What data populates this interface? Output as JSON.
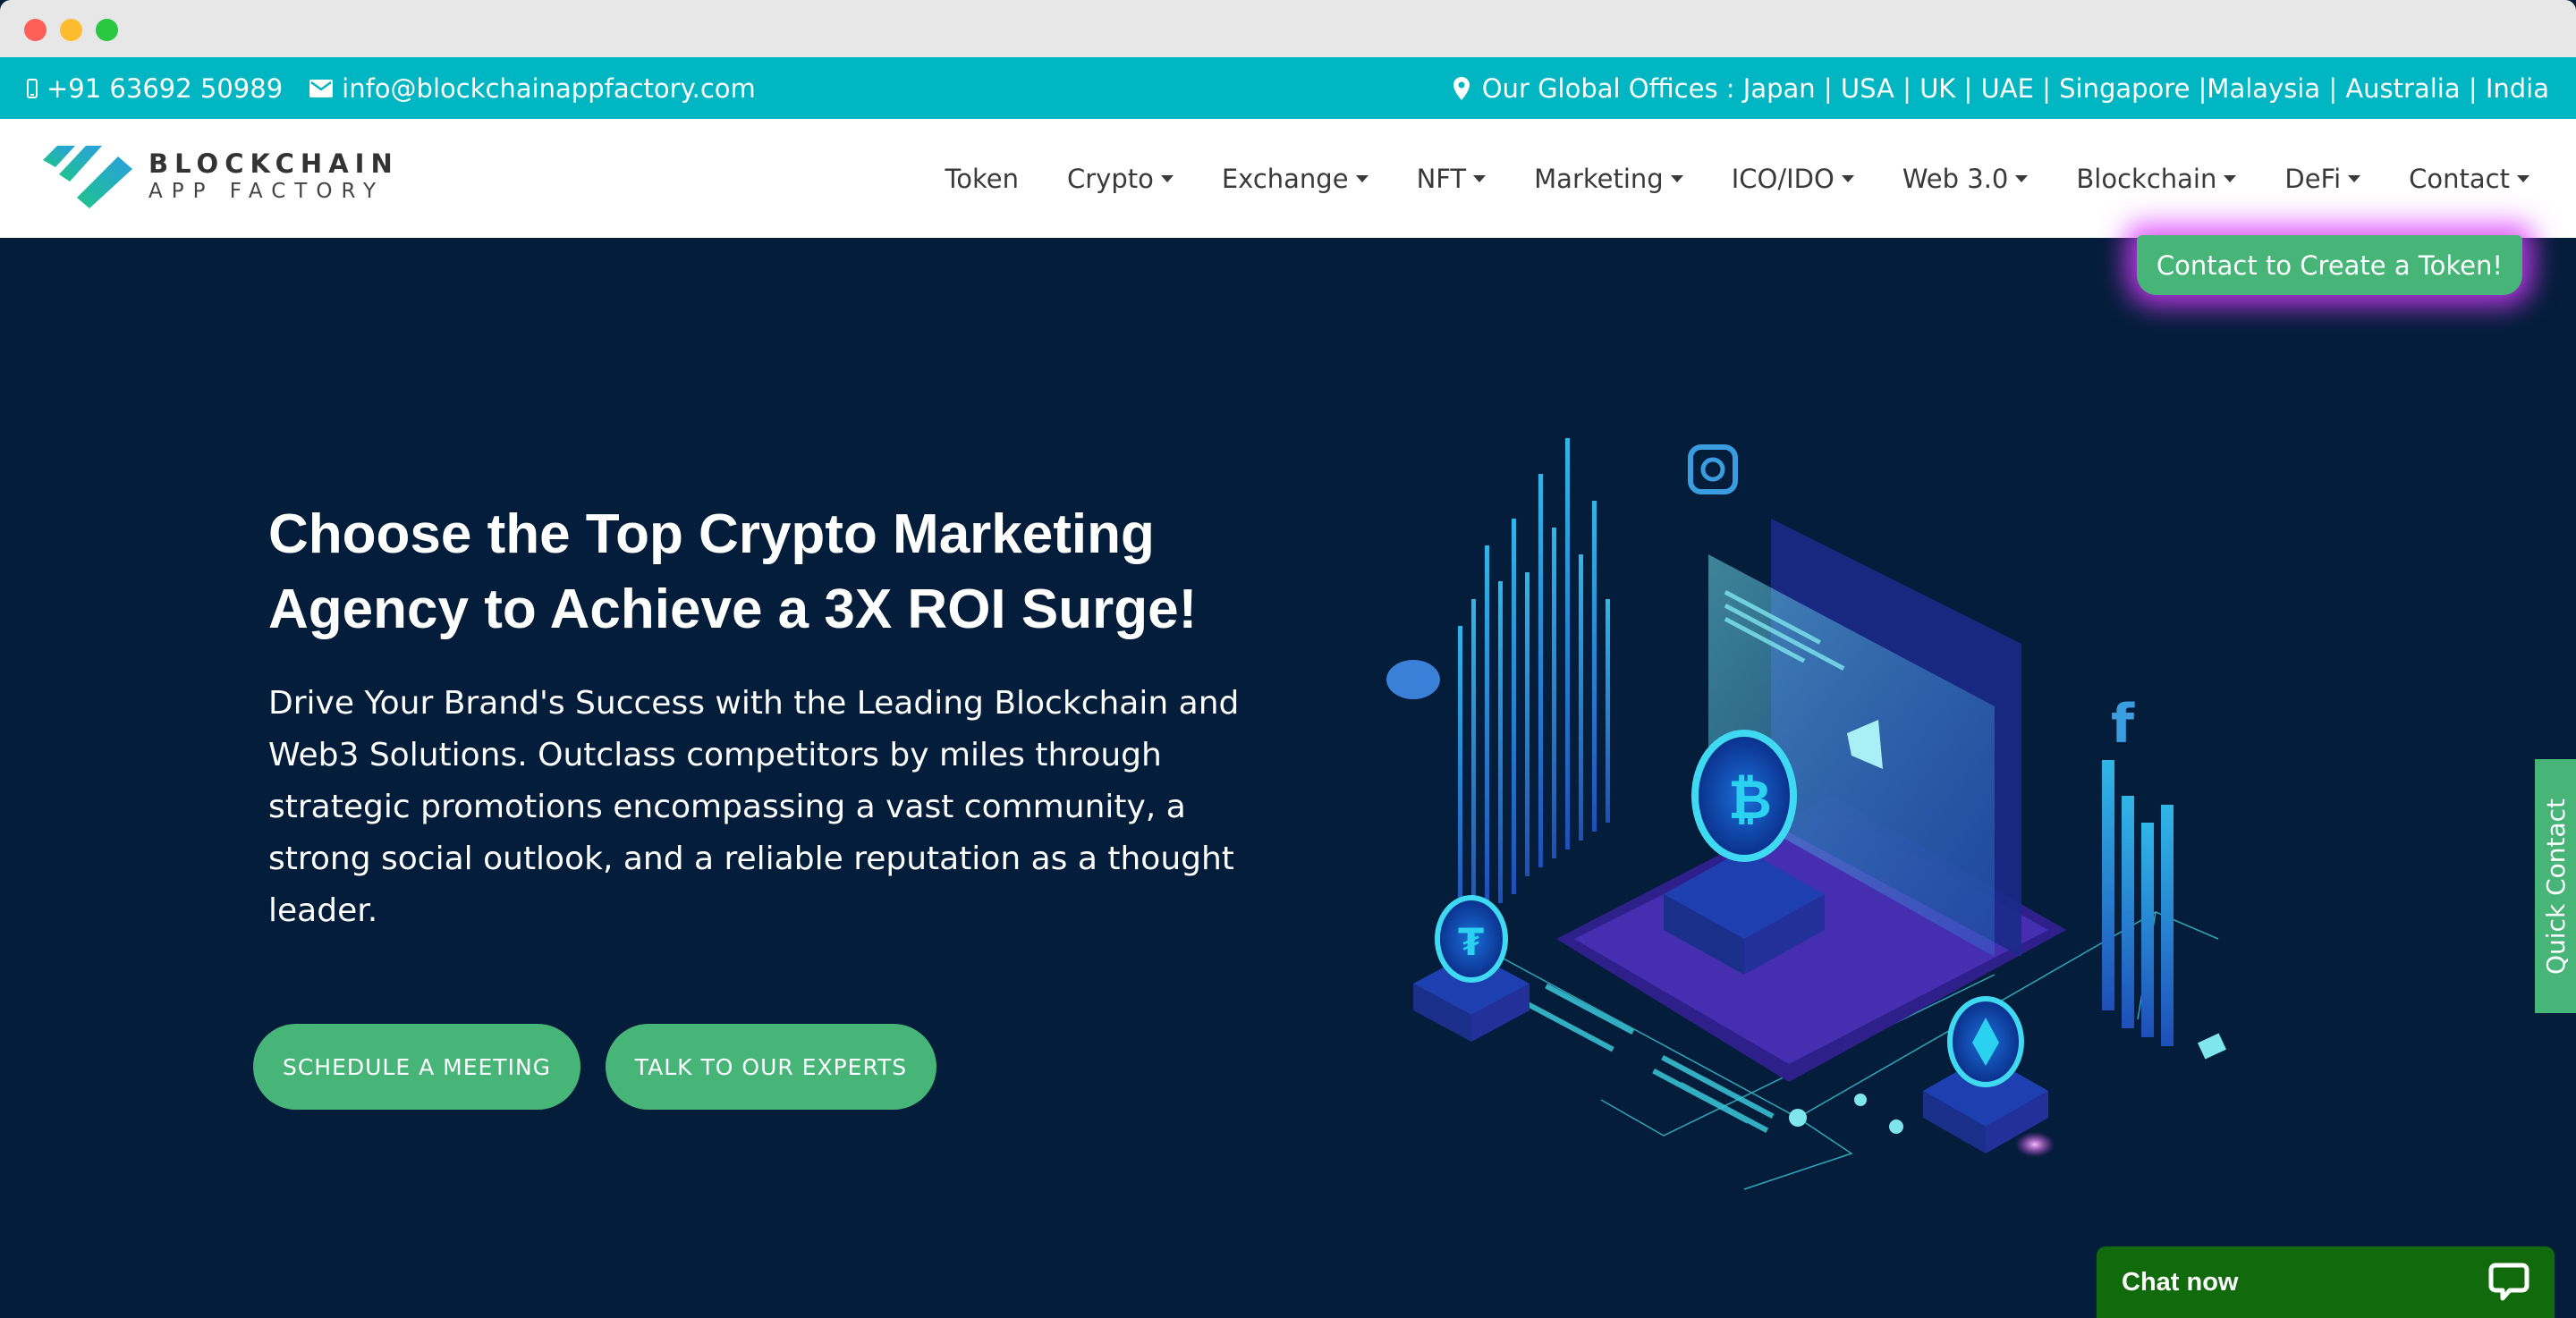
{
  "window": {
    "controls": [
      "close",
      "minimize",
      "maximize"
    ]
  },
  "topbar": {
    "phone_icon": "mobile-phone-icon",
    "phone": "+91 63692 50989",
    "email_icon": "envelope-icon",
    "email": "info@blockchainappfactory.com",
    "location_icon": "map-marker-icon",
    "offices": "Our Global Offices : Japan | USA | UK | UAE | Singapore |Malaysia | Australia | India"
  },
  "logo": {
    "line1": "BLOCKCHAIN",
    "line2": "APP FACTORY"
  },
  "nav": {
    "items": [
      {
        "label": "Token",
        "dropdown": false
      },
      {
        "label": "Crypto",
        "dropdown": true
      },
      {
        "label": "Exchange",
        "dropdown": true
      },
      {
        "label": "NFT",
        "dropdown": true
      },
      {
        "label": "Marketing",
        "dropdown": true
      },
      {
        "label": "ICO/IDO",
        "dropdown": true
      },
      {
        "label": "Web 3.0",
        "dropdown": true
      },
      {
        "label": "Blockchain",
        "dropdown": true
      },
      {
        "label": "DeFi",
        "dropdown": true
      },
      {
        "label": "Contact",
        "dropdown": true
      }
    ]
  },
  "hero": {
    "cta_token": "Contact to Create a Token!",
    "headline": "Choose the Top Crypto Marketing Agency to Achieve a 3X ROI Surge!",
    "subtext": "Drive Your Brand's Success with the Leading Blockchain and Web3 Solutions. Outclass competitors by miles through strategic promotions encompassing a vast community, a strong social outlook, and a reliable reputation as a thought leader.",
    "buttons": {
      "schedule": "SCHEDULE A MEETING",
      "experts": "TALK TO OUR EXPERTS"
    },
    "illustration": "isometric-crypto-marketing-illustration"
  },
  "quick_contact": "Quick Contact",
  "chat": {
    "label": "Chat now",
    "icon": "chat-bubble-icon"
  },
  "colors": {
    "topbar": "#00b6c2",
    "hero_bg": "#041d3a",
    "button_green": "#48b578",
    "chat_green": "#116a0b",
    "glow": "#d83cff"
  }
}
